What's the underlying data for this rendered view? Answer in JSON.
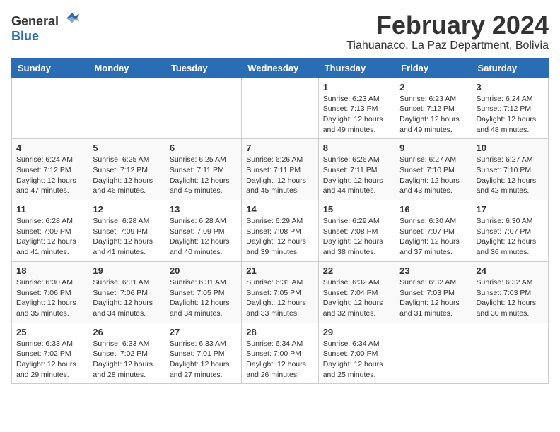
{
  "logo": {
    "text_general": "General",
    "text_blue": "Blue"
  },
  "title": "February 2024",
  "subtitle": "Tiahuanaco, La Paz Department, Bolivia",
  "days_of_week": [
    "Sunday",
    "Monday",
    "Tuesday",
    "Wednesday",
    "Thursday",
    "Friday",
    "Saturday"
  ],
  "weeks": [
    [
      {
        "day": "",
        "info": ""
      },
      {
        "day": "",
        "info": ""
      },
      {
        "day": "",
        "info": ""
      },
      {
        "day": "",
        "info": ""
      },
      {
        "day": "1",
        "info": "Sunrise: 6:23 AM\nSunset: 7:13 PM\nDaylight: 12 hours\nand 49 minutes."
      },
      {
        "day": "2",
        "info": "Sunrise: 6:23 AM\nSunset: 7:12 PM\nDaylight: 12 hours\nand 49 minutes."
      },
      {
        "day": "3",
        "info": "Sunrise: 6:24 AM\nSunset: 7:12 PM\nDaylight: 12 hours\nand 48 minutes."
      }
    ],
    [
      {
        "day": "4",
        "info": "Sunrise: 6:24 AM\nSunset: 7:12 PM\nDaylight: 12 hours\nand 47 minutes."
      },
      {
        "day": "5",
        "info": "Sunrise: 6:25 AM\nSunset: 7:12 PM\nDaylight: 12 hours\nand 46 minutes."
      },
      {
        "day": "6",
        "info": "Sunrise: 6:25 AM\nSunset: 7:11 PM\nDaylight: 12 hours\nand 45 minutes."
      },
      {
        "day": "7",
        "info": "Sunrise: 6:26 AM\nSunset: 7:11 PM\nDaylight: 12 hours\nand 45 minutes."
      },
      {
        "day": "8",
        "info": "Sunrise: 6:26 AM\nSunset: 7:11 PM\nDaylight: 12 hours\nand 44 minutes."
      },
      {
        "day": "9",
        "info": "Sunrise: 6:27 AM\nSunset: 7:10 PM\nDaylight: 12 hours\nand 43 minutes."
      },
      {
        "day": "10",
        "info": "Sunrise: 6:27 AM\nSunset: 7:10 PM\nDaylight: 12 hours\nand 42 minutes."
      }
    ],
    [
      {
        "day": "11",
        "info": "Sunrise: 6:28 AM\nSunset: 7:09 PM\nDaylight: 12 hours\nand 41 minutes."
      },
      {
        "day": "12",
        "info": "Sunrise: 6:28 AM\nSunset: 7:09 PM\nDaylight: 12 hours\nand 41 minutes."
      },
      {
        "day": "13",
        "info": "Sunrise: 6:28 AM\nSunset: 7:09 PM\nDaylight: 12 hours\nand 40 minutes."
      },
      {
        "day": "14",
        "info": "Sunrise: 6:29 AM\nSunset: 7:08 PM\nDaylight: 12 hours\nand 39 minutes."
      },
      {
        "day": "15",
        "info": "Sunrise: 6:29 AM\nSunset: 7:08 PM\nDaylight: 12 hours\nand 38 minutes."
      },
      {
        "day": "16",
        "info": "Sunrise: 6:30 AM\nSunset: 7:07 PM\nDaylight: 12 hours\nand 37 minutes."
      },
      {
        "day": "17",
        "info": "Sunrise: 6:30 AM\nSunset: 7:07 PM\nDaylight: 12 hours\nand 36 minutes."
      }
    ],
    [
      {
        "day": "18",
        "info": "Sunrise: 6:30 AM\nSunset: 7:06 PM\nDaylight: 12 hours\nand 35 minutes."
      },
      {
        "day": "19",
        "info": "Sunrise: 6:31 AM\nSunset: 7:06 PM\nDaylight: 12 hours\nand 34 minutes."
      },
      {
        "day": "20",
        "info": "Sunrise: 6:31 AM\nSunset: 7:05 PM\nDaylight: 12 hours\nand 34 minutes."
      },
      {
        "day": "21",
        "info": "Sunrise: 6:31 AM\nSunset: 7:05 PM\nDaylight: 12 hours\nand 33 minutes."
      },
      {
        "day": "22",
        "info": "Sunrise: 6:32 AM\nSunset: 7:04 PM\nDaylight: 12 hours\nand 32 minutes."
      },
      {
        "day": "23",
        "info": "Sunrise: 6:32 AM\nSunset: 7:03 PM\nDaylight: 12 hours\nand 31 minutes."
      },
      {
        "day": "24",
        "info": "Sunrise: 6:32 AM\nSunset: 7:03 PM\nDaylight: 12 hours\nand 30 minutes."
      }
    ],
    [
      {
        "day": "25",
        "info": "Sunrise: 6:33 AM\nSunset: 7:02 PM\nDaylight: 12 hours\nand 29 minutes."
      },
      {
        "day": "26",
        "info": "Sunrise: 6:33 AM\nSunset: 7:02 PM\nDaylight: 12 hours\nand 28 minutes."
      },
      {
        "day": "27",
        "info": "Sunrise: 6:33 AM\nSunset: 7:01 PM\nDaylight: 12 hours\nand 27 minutes."
      },
      {
        "day": "28",
        "info": "Sunrise: 6:34 AM\nSunset: 7:00 PM\nDaylight: 12 hours\nand 26 minutes."
      },
      {
        "day": "29",
        "info": "Sunrise: 6:34 AM\nSunset: 7:00 PM\nDaylight: 12 hours\nand 25 minutes."
      },
      {
        "day": "",
        "info": ""
      },
      {
        "day": "",
        "info": ""
      }
    ]
  ]
}
